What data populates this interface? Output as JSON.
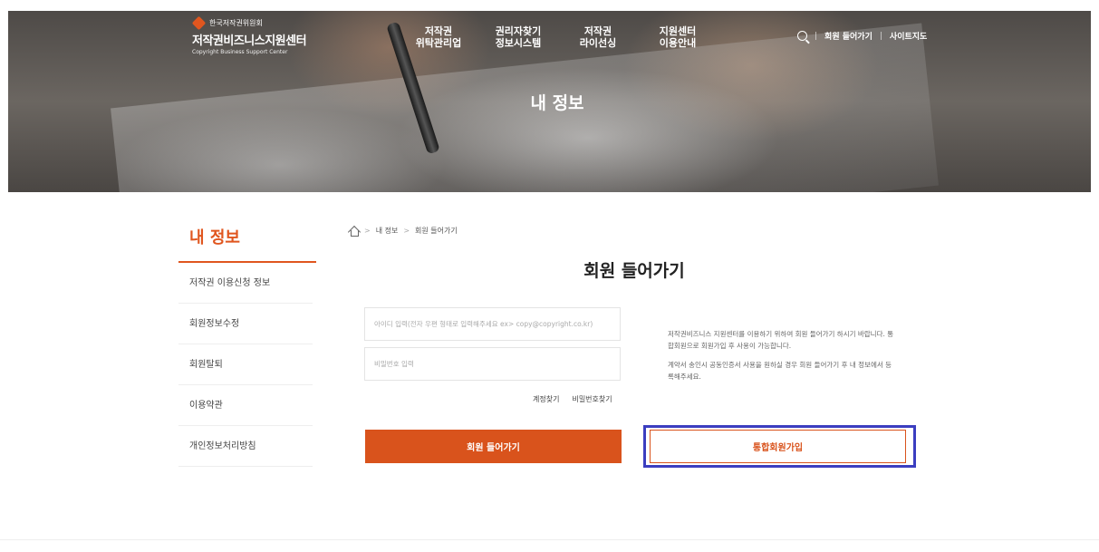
{
  "header": {
    "logo": {
      "org": "한국저작권위원회",
      "name": "저작권비즈니스지원센터",
      "sub": "Copyright Business Support Center"
    },
    "nav": [
      {
        "line1": "저작권",
        "line2": "위탁관리업"
      },
      {
        "line1": "권리자찾기",
        "line2": "정보시스템"
      },
      {
        "line1": "저작권",
        "line2": "라이선싱"
      },
      {
        "line1": "지원센터",
        "line2": "이용안내"
      }
    ],
    "util": {
      "sep": "|",
      "login": "회원 들어가기",
      "sitemap": "사이트지도"
    },
    "hero_title": "내 정보"
  },
  "sidebar": {
    "title": "내 정보",
    "items": [
      "저작권 이용신청 정보",
      "회원정보수정",
      "회원탈퇴",
      "이용약관",
      "개인정보처리방침"
    ]
  },
  "breadcrumb": {
    "sep": ">",
    "items": [
      "내 정보",
      "회원 들어가기"
    ]
  },
  "login": {
    "title": "회원 들어가기",
    "id_placeholder": "아이디 입력(전자 우편 형태로 입력해주세요 ex> copy@copyright.co.kr)",
    "pw_placeholder": "비밀번호 입력",
    "find_account": "계정찾기",
    "find_password": "비밀번호찾기",
    "login_button": "회원 들어가기",
    "join_button": "통합회원가입",
    "info1": "저작권비즈니스 지원센터를 이용하기 위하여 회원 들어가기 하시기 바랍니다. 통합회원으로 회원가입 후 사용이 가능합니다.",
    "info2": "계약서 송인시 공동인증서 사용을 원하실 경우 회원 들어가기 후 내 정보에서 등록해주세요."
  },
  "colors": {
    "accent": "#d9531c",
    "highlight": "#3b3ec0"
  }
}
